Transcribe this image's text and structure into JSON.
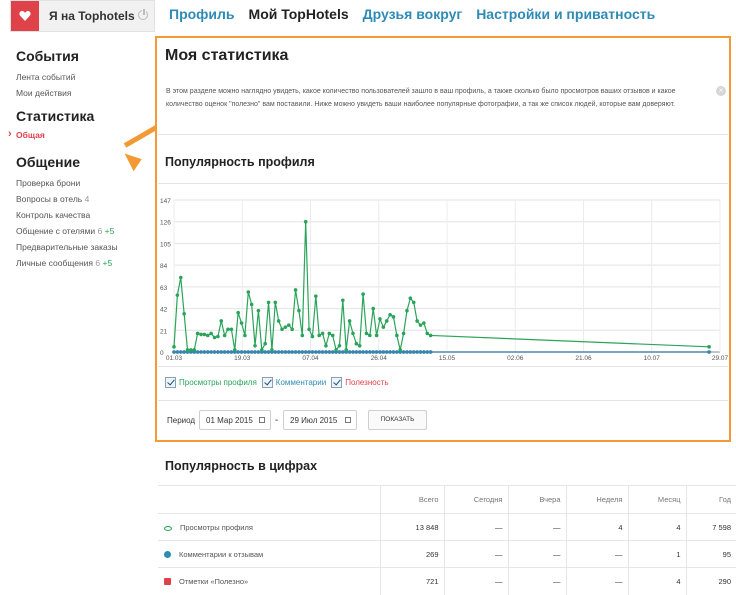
{
  "header": {
    "logo_text": "Я на Tophotels",
    "nav": [
      "Профиль",
      "Мой TopHotels",
      "Друзья вокруг",
      "Настройки и приватность"
    ],
    "nav_active": "Мой TopHotels"
  },
  "sidebar": {
    "events_heading": "События",
    "events": [
      "Лента событий",
      "Мои действия"
    ],
    "stats_heading": "Статистика",
    "stats_active": "Общая",
    "comm_heading": "Общение",
    "comm": [
      {
        "label": "Проверка брони",
        "count": "",
        "plus": ""
      },
      {
        "label": "Вопросы в отель",
        "count": "4",
        "plus": ""
      },
      {
        "label": "Контроль качества",
        "count": "",
        "plus": ""
      },
      {
        "label": "Общение с отелями",
        "count": "6",
        "plus": "+5"
      },
      {
        "label": "Предварительные заказы",
        "count": "",
        "plus": ""
      },
      {
        "label": "Личные сообщения",
        "count": "6",
        "plus": "+5"
      }
    ]
  },
  "panel": {
    "title": "Моя статистика",
    "description": "В этом разделе можно наглядно увидеть, какое количество пользователей зашло в ваш профиль, а также сколько было просмотров ваших отзывов и какое количество оценок \"полезно\" вам поставили. Ниже можно увидеть ваши наиболее популярные фотографии, а так же список людей, которые вам доверяют.",
    "chart_title": "Популярность профиля",
    "legend": {
      "views": "Просмотры профиля",
      "comments": "Комментарии",
      "useful": "Полезность"
    },
    "period_label": "Период",
    "date_from": "01 Мар 2015",
    "date_to": "29 Июл 2015",
    "show_button": "ПОКАЗАТЬ"
  },
  "colors": {
    "accent_orange": "#f39a34",
    "views_green": "#2aa45b",
    "comments_blue": "#2f8bb5",
    "useful_red": "#e0424a"
  },
  "chart_data": {
    "type": "line",
    "y_ticks": [
      "0",
      "21",
      "42",
      "63",
      "84",
      "105",
      "126",
      "147"
    ],
    "x_ticks": [
      "01.03",
      "19.03",
      "07.04",
      "26.04",
      "15.05",
      "02.06",
      "21.06",
      "10.07",
      "29.07"
    ],
    "ylim": [
      0,
      147
    ],
    "grid": true,
    "series": [
      {
        "name": "Просмотры профиля",
        "color": "#2aa45b",
        "values": [
          5,
          55,
          72,
          37,
          2,
          2,
          2,
          18,
          17,
          17,
          16,
          18,
          14,
          15,
          30,
          16,
          22,
          22,
          2,
          38,
          28,
          16,
          58,
          46,
          6,
          40,
          2,
          8,
          48,
          2,
          48,
          30,
          22,
          24,
          26,
          22,
          60,
          40,
          16,
          126,
          22,
          15,
          54,
          16,
          18,
          6,
          18,
          16,
          2,
          6,
          50,
          2,
          30,
          18,
          8,
          6,
          56,
          18,
          16,
          42,
          16,
          32,
          24,
          30,
          36,
          34,
          16,
          2,
          18,
          40,
          52,
          48,
          30,
          26,
          28,
          18,
          16,
          5
        ]
      },
      {
        "name": "Комментарии",
        "color": "#2f8bb5",
        "values": [
          0,
          0,
          0,
          0,
          0,
          0,
          0,
          0,
          0,
          0,
          0,
          0,
          0,
          0,
          0,
          0,
          0,
          0,
          0,
          0,
          0,
          0,
          0,
          0,
          0,
          0,
          0,
          0,
          0,
          0,
          0,
          0,
          0,
          0,
          0,
          0,
          0,
          0,
          0,
          0,
          0,
          0,
          0,
          0,
          0,
          0,
          0,
          0,
          0,
          0,
          0,
          0,
          0,
          0,
          0,
          0,
          0,
          0,
          0,
          0,
          0,
          0,
          0,
          0,
          0,
          0,
          0,
          0,
          0,
          0,
          0,
          0,
          0,
          0,
          0,
          0,
          0,
          0
        ]
      },
      {
        "name": "Полезность",
        "color": "#e0424a",
        "values": [
          0,
          0,
          0,
          0,
          0,
          0,
          0,
          0,
          0,
          0,
          0,
          0,
          0,
          0,
          0,
          0,
          0,
          0,
          0,
          0,
          0,
          0,
          0,
          0,
          0,
          0,
          0,
          0,
          0,
          0,
          0,
          0,
          0,
          0,
          0,
          0,
          0,
          0,
          0,
          0,
          0,
          0,
          0,
          0,
          0,
          0,
          0,
          0,
          0,
          0,
          0,
          0,
          0,
          0,
          0,
          0,
          0,
          0,
          0,
          0,
          0,
          0,
          0,
          0,
          0,
          0,
          0,
          0,
          0,
          0,
          0,
          0,
          0,
          0,
          0,
          0,
          0,
          0
        ]
      }
    ]
  },
  "numbers": {
    "title": "Популярность в цифрах",
    "columns": [
      "Всего",
      "Сегодня",
      "Вчера",
      "Неделя",
      "Месяц",
      "Год"
    ],
    "rows": [
      {
        "label": "Просмотры профиля",
        "values": [
          "13 848",
          "—",
          "—",
          "4",
          "4",
          "7 598"
        ]
      },
      {
        "label": "Комментарии к отзывам",
        "values": [
          "269",
          "—",
          "—",
          "—",
          "1",
          "95"
        ]
      },
      {
        "label": "Отметки «Полезно»",
        "values": [
          "721",
          "—",
          "—",
          "—",
          "4",
          "290"
        ]
      }
    ]
  }
}
